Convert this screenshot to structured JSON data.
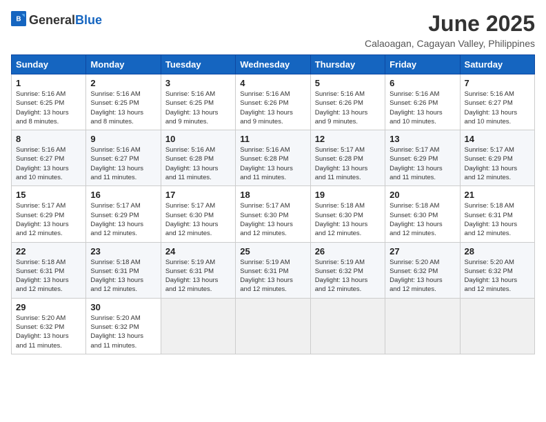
{
  "logo": {
    "general": "General",
    "blue": "Blue"
  },
  "title": {
    "month_year": "June 2025",
    "location": "Calaoagan, Cagayan Valley, Philippines"
  },
  "weekdays": [
    "Sunday",
    "Monday",
    "Tuesday",
    "Wednesday",
    "Thursday",
    "Friday",
    "Saturday"
  ],
  "weeks": [
    [
      {
        "day": "1",
        "sunrise": "5:16 AM",
        "sunset": "6:25 PM",
        "daylight": "13 hours and 8 minutes."
      },
      {
        "day": "2",
        "sunrise": "5:16 AM",
        "sunset": "6:25 PM",
        "daylight": "13 hours and 8 minutes."
      },
      {
        "day": "3",
        "sunrise": "5:16 AM",
        "sunset": "6:25 PM",
        "daylight": "13 hours and 9 minutes."
      },
      {
        "day": "4",
        "sunrise": "5:16 AM",
        "sunset": "6:26 PM",
        "daylight": "13 hours and 9 minutes."
      },
      {
        "day": "5",
        "sunrise": "5:16 AM",
        "sunset": "6:26 PM",
        "daylight": "13 hours and 9 minutes."
      },
      {
        "day": "6",
        "sunrise": "5:16 AM",
        "sunset": "6:26 PM",
        "daylight": "13 hours and 10 minutes."
      },
      {
        "day": "7",
        "sunrise": "5:16 AM",
        "sunset": "6:27 PM",
        "daylight": "13 hours and 10 minutes."
      }
    ],
    [
      {
        "day": "8",
        "sunrise": "5:16 AM",
        "sunset": "6:27 PM",
        "daylight": "13 hours and 10 minutes."
      },
      {
        "day": "9",
        "sunrise": "5:16 AM",
        "sunset": "6:27 PM",
        "daylight": "13 hours and 11 minutes."
      },
      {
        "day": "10",
        "sunrise": "5:16 AM",
        "sunset": "6:28 PM",
        "daylight": "13 hours and 11 minutes."
      },
      {
        "day": "11",
        "sunrise": "5:16 AM",
        "sunset": "6:28 PM",
        "daylight": "13 hours and 11 minutes."
      },
      {
        "day": "12",
        "sunrise": "5:17 AM",
        "sunset": "6:28 PM",
        "daylight": "13 hours and 11 minutes."
      },
      {
        "day": "13",
        "sunrise": "5:17 AM",
        "sunset": "6:29 PM",
        "daylight": "13 hours and 11 minutes."
      },
      {
        "day": "14",
        "sunrise": "5:17 AM",
        "sunset": "6:29 PM",
        "daylight": "13 hours and 12 minutes."
      }
    ],
    [
      {
        "day": "15",
        "sunrise": "5:17 AM",
        "sunset": "6:29 PM",
        "daylight": "13 hours and 12 minutes."
      },
      {
        "day": "16",
        "sunrise": "5:17 AM",
        "sunset": "6:29 PM",
        "daylight": "13 hours and 12 minutes."
      },
      {
        "day": "17",
        "sunrise": "5:17 AM",
        "sunset": "6:30 PM",
        "daylight": "13 hours and 12 minutes."
      },
      {
        "day": "18",
        "sunrise": "5:17 AM",
        "sunset": "6:30 PM",
        "daylight": "13 hours and 12 minutes."
      },
      {
        "day": "19",
        "sunrise": "5:18 AM",
        "sunset": "6:30 PM",
        "daylight": "13 hours and 12 minutes."
      },
      {
        "day": "20",
        "sunrise": "5:18 AM",
        "sunset": "6:30 PM",
        "daylight": "13 hours and 12 minutes."
      },
      {
        "day": "21",
        "sunrise": "5:18 AM",
        "sunset": "6:31 PM",
        "daylight": "13 hours and 12 minutes."
      }
    ],
    [
      {
        "day": "22",
        "sunrise": "5:18 AM",
        "sunset": "6:31 PM",
        "daylight": "13 hours and 12 minutes."
      },
      {
        "day": "23",
        "sunrise": "5:18 AM",
        "sunset": "6:31 PM",
        "daylight": "13 hours and 12 minutes."
      },
      {
        "day": "24",
        "sunrise": "5:19 AM",
        "sunset": "6:31 PM",
        "daylight": "13 hours and 12 minutes."
      },
      {
        "day": "25",
        "sunrise": "5:19 AM",
        "sunset": "6:31 PM",
        "daylight": "13 hours and 12 minutes."
      },
      {
        "day": "26",
        "sunrise": "5:19 AM",
        "sunset": "6:32 PM",
        "daylight": "13 hours and 12 minutes."
      },
      {
        "day": "27",
        "sunrise": "5:20 AM",
        "sunset": "6:32 PM",
        "daylight": "13 hours and 12 minutes."
      },
      {
        "day": "28",
        "sunrise": "5:20 AM",
        "sunset": "6:32 PM",
        "daylight": "13 hours and 12 minutes."
      }
    ],
    [
      {
        "day": "29",
        "sunrise": "5:20 AM",
        "sunset": "6:32 PM",
        "daylight": "13 hours and 11 minutes."
      },
      {
        "day": "30",
        "sunrise": "5:20 AM",
        "sunset": "6:32 PM",
        "daylight": "13 hours and 11 minutes."
      },
      null,
      null,
      null,
      null,
      null
    ]
  ],
  "labels": {
    "sunrise": "Sunrise:",
    "sunset": "Sunset:",
    "daylight": "Daylight:"
  }
}
